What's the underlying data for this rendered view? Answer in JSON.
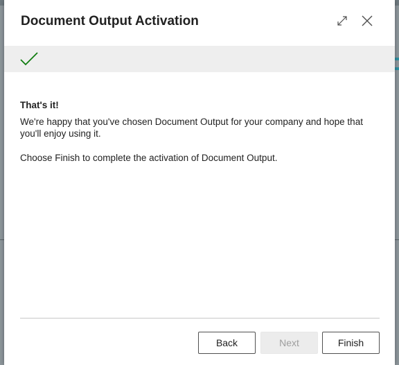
{
  "dialog": {
    "title": "Document Output Activation"
  },
  "header_buttons": {
    "expand_icon": "expand-arrows-icon",
    "close_icon": "close-icon"
  },
  "banner": {
    "icon": "checkmark-icon",
    "check_color": "#107c10"
  },
  "content": {
    "heading": "That's it!",
    "paragraph1": "We're happy that you've chosen Document Output for your company and hope that you'll enjoy using it.",
    "paragraph2": "Choose Finish to complete the activation of Document Output."
  },
  "footer": {
    "back_label": "Back",
    "next_label": "Next",
    "finish_label": "Finish",
    "next_disabled": true
  }
}
